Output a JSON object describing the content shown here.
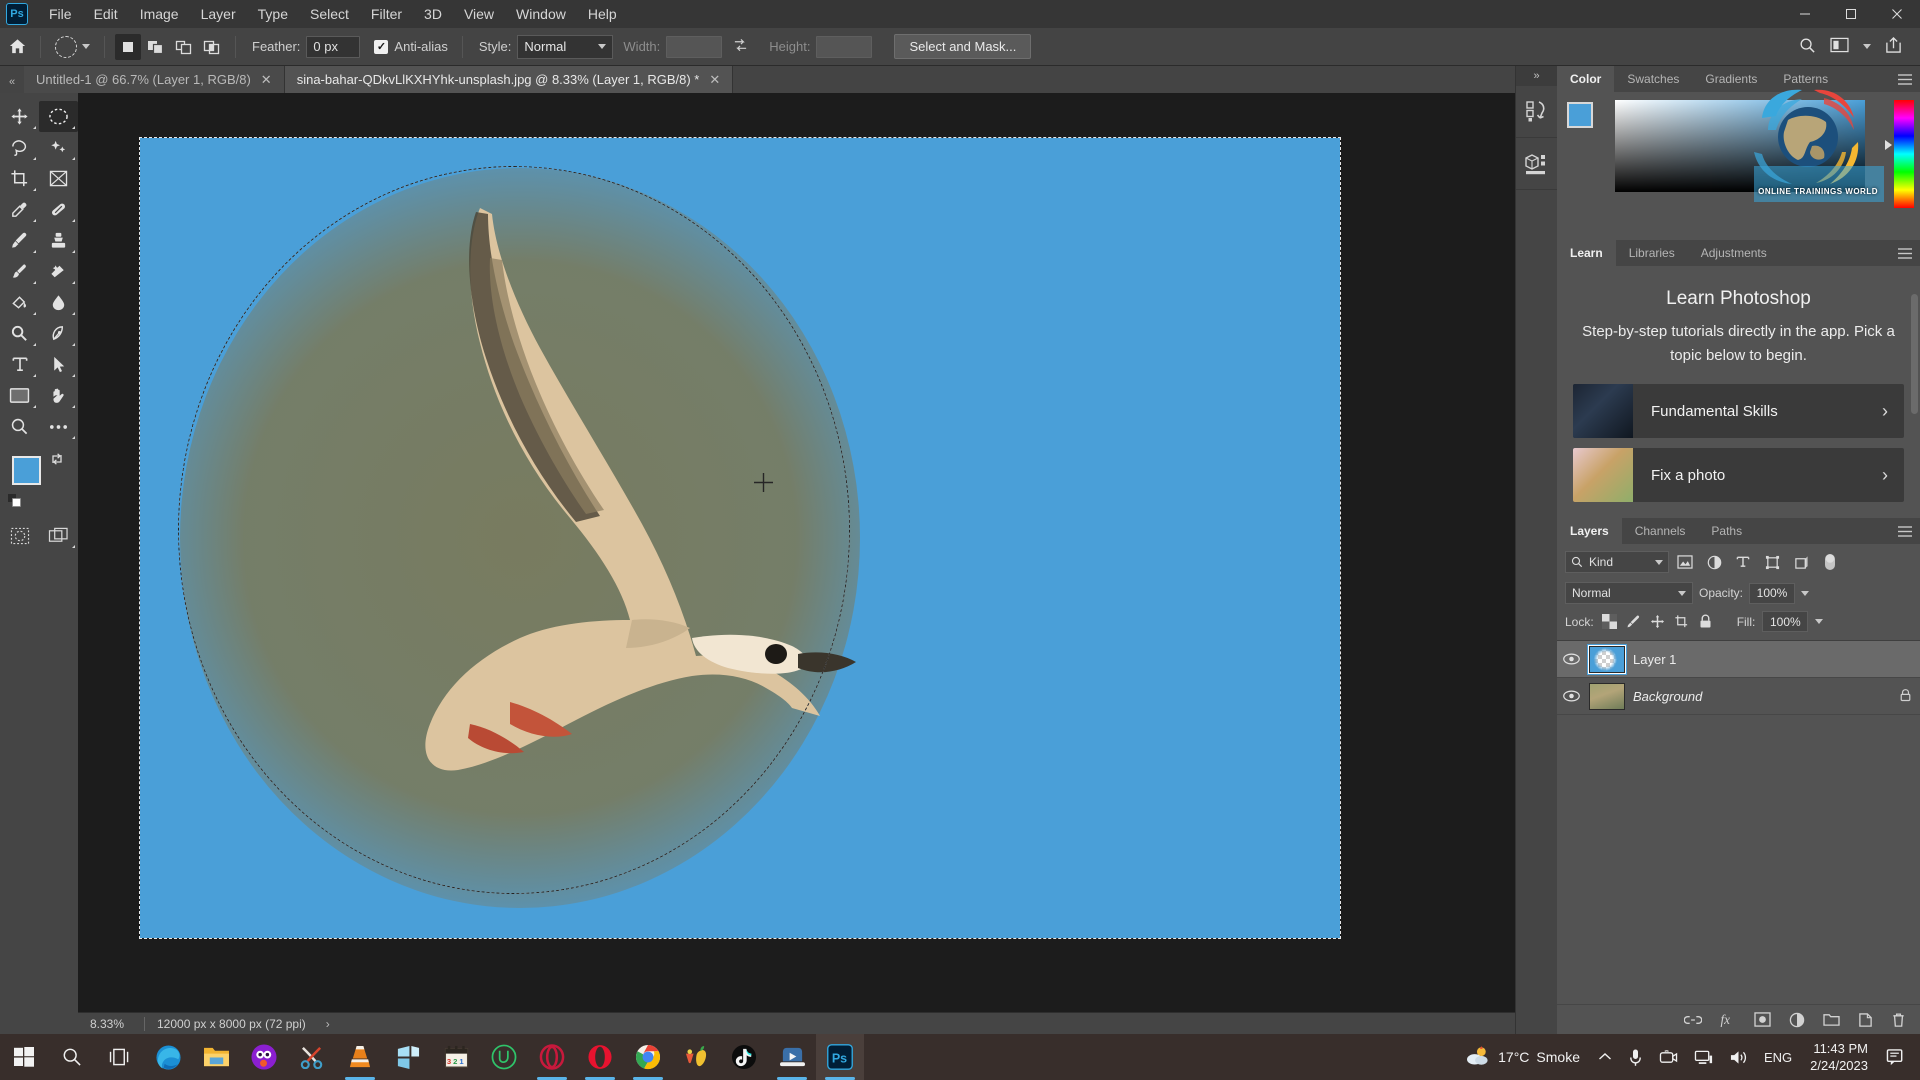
{
  "menubar": {
    "app_icon": "photoshop-logo-icon",
    "items": [
      "File",
      "Edit",
      "Image",
      "Layer",
      "Type",
      "Select",
      "Filter",
      "3D",
      "View",
      "Window",
      "Help"
    ],
    "window_controls": [
      {
        "name": "minimize",
        "glyph": "—"
      },
      {
        "name": "maximize",
        "glyph": "❐"
      },
      {
        "name": "close",
        "glyph": "✕"
      }
    ]
  },
  "options_bar": {
    "home_icon": "home-icon",
    "tool_preset_label": "elliptical-marquee-tool",
    "selection_modes": [
      "new-selection",
      "add-to-selection",
      "subtract-from-selection",
      "intersect-with-selection"
    ],
    "active_selection_mode": 0,
    "feather_label": "Feather:",
    "feather_value": "0 px",
    "antialias_label": "Anti-alias",
    "antialias_checked": true,
    "style_label": "Style:",
    "style_value": "Normal",
    "width_label": "Width:",
    "width_value": "",
    "swap_icon": "swap-width-height-icon",
    "height_label": "Height:",
    "height_value": "",
    "select_and_mask_label": "Select and Mask...",
    "right_icons": [
      "search-icon",
      "arrange-documents-icon",
      "chevron-down-icon",
      "share-icon"
    ]
  },
  "tab_bar": {
    "collapse_glyph": "«",
    "tabs": [
      {
        "title": "Untitled-1 @ 66.7% (Layer 1, RGB/8)",
        "active": false,
        "close": "✕"
      },
      {
        "title": "sina-bahar-QDkvLlKXHYhk-unsplash.jpg @ 8.33% (Layer 1, RGB/8) *",
        "active": true,
        "close": "✕"
      }
    ]
  },
  "toolbar": {
    "tools": [
      {
        "name": "move-tool",
        "active": false
      },
      {
        "name": "elliptical-marquee-tool",
        "active": true
      },
      {
        "name": "lasso-tool",
        "active": false
      },
      {
        "name": "object-selection-tool",
        "active": false
      },
      {
        "name": "crop-tool",
        "active": false
      },
      {
        "name": "frame-tool",
        "active": false
      },
      {
        "name": "eyedropper-tool",
        "active": false
      },
      {
        "name": "spot-healing-brush-tool",
        "active": false
      },
      {
        "name": "brush-tool",
        "active": false
      },
      {
        "name": "clone-stamp-tool",
        "active": false
      },
      {
        "name": "history-brush-tool",
        "active": false
      },
      {
        "name": "eraser-tool",
        "active": false
      },
      {
        "name": "gradient-tool",
        "active": false
      },
      {
        "name": "blur-tool",
        "active": false
      },
      {
        "name": "dodge-tool",
        "active": false
      },
      {
        "name": "pen-tool",
        "active": false
      },
      {
        "name": "horizontal-type-tool",
        "active": false
      },
      {
        "name": "path-selection-tool",
        "active": false
      },
      {
        "name": "rectangle-tool",
        "active": false
      },
      {
        "name": "hand-tool",
        "active": false
      },
      {
        "name": "zoom-tool",
        "active": false
      },
      {
        "name": "edit-toolbar-tool",
        "active": false
      }
    ],
    "foreground_color": "#4a9fd8",
    "background_color": "#ffffff",
    "swap_icon": "swap-colors-icon",
    "reset_icon": "default-colors-icon",
    "bottom_tools": [
      {
        "name": "quick-mask-mode-icon"
      },
      {
        "name": "screen-mode-icon"
      }
    ]
  },
  "canvas": {
    "image_background_color": "#4a9fd8",
    "selection_shape": "ellipse",
    "cursor_icon": "crosshair-cursor"
  },
  "status_bar": {
    "zoom": "8.33%",
    "dimensions": "12000 px x 8000 px (72 ppi)",
    "expand_glyph": "›"
  },
  "dock_strip": {
    "collapse_glyph": "»",
    "buttons": [
      "history-panel-icon",
      "properties-panel-icon"
    ]
  },
  "color_panel": {
    "tabs": [
      "Color",
      "Swatches",
      "Gradients",
      "Patterns"
    ],
    "active_tab": "Color",
    "foreground": "#4a9fd8",
    "background": "#ffffff",
    "menu_icon": "panel-menu-icon",
    "watermark_text": "ONLINE TRAININGS WORLD"
  },
  "learn_panel": {
    "tabs": [
      "Learn",
      "Libraries",
      "Adjustments"
    ],
    "active_tab": "Learn",
    "title": "Learn Photoshop",
    "subtitle": "Step-by-step tutorials directly in the app. Pick a topic below to begin.",
    "cards": [
      {
        "label": "Fundamental Skills",
        "chevron": "›",
        "thumb": "dark-room-thumbnail"
      },
      {
        "label": "Fix a photo",
        "chevron": "›",
        "thumb": "flowers-thumbnail"
      }
    ]
  },
  "layers_panel": {
    "tabs": [
      "Layers",
      "Channels",
      "Paths"
    ],
    "active_tab": "Layers",
    "filter_label": "Kind",
    "filter_icon": "search-icon",
    "filter_type_icons": [
      "pixel-layer-filter-icon",
      "adjustment-layer-filter-icon",
      "type-layer-filter-icon",
      "shape-layer-filter-icon",
      "smart-object-filter-icon"
    ],
    "filter_toggle_icon": "filter-toggle-icon",
    "blend_mode": "Normal",
    "opacity_label": "Opacity:",
    "opacity_value": "100%",
    "lock_label": "Lock:",
    "lock_icons": [
      "lock-transparent-pixels-icon",
      "lock-image-pixels-icon",
      "lock-position-icon",
      "lock-artboard-icon",
      "lock-all-icon"
    ],
    "fill_label": "Fill:",
    "fill_value": "100%",
    "layers": [
      {
        "name": "Layer 1",
        "visible": true,
        "selected": true,
        "locked": false,
        "italic": false
      },
      {
        "name": "Background",
        "visible": true,
        "selected": false,
        "locked": true,
        "italic": true
      }
    ],
    "footer_icons": [
      "link-layers-icon",
      "layer-style-icon",
      "layer-mask-icon",
      "adjustment-layer-icon",
      "new-group-icon",
      "new-layer-icon",
      "delete-layer-icon"
    ]
  },
  "taskbar": {
    "start_icon": "windows-start-icon",
    "search_icon": "search-icon",
    "task-view_icon": "task-view-icon",
    "apps": [
      {
        "name": "microsoft-edge",
        "running": false
      },
      {
        "name": "file-explorer",
        "running": false
      },
      {
        "name": "app-purple",
        "running": false
      },
      {
        "name": "snipping-tool",
        "running": false
      },
      {
        "name": "vlc-media-player",
        "running": true
      },
      {
        "name": "microsoft-store",
        "running": false
      },
      {
        "name": "calendar-app",
        "running": false
      },
      {
        "name": "iobit-uninstaller",
        "running": false
      },
      {
        "name": "opera-gx",
        "running": true
      },
      {
        "name": "opera-browser",
        "running": true
      },
      {
        "name": "google-chrome",
        "running": true
      },
      {
        "name": "fruit-app",
        "running": false
      },
      {
        "name": "tiktok",
        "running": false
      },
      {
        "name": "filmora",
        "running": true
      },
      {
        "name": "photoshop",
        "running": true,
        "active": true
      }
    ],
    "tray": {
      "weather_temp": "17°C",
      "weather_condition": "Smoke",
      "weather_icon": "sun-cloud-icon",
      "chevron_icon": "show-hidden-icons-icon",
      "icons": [
        "microphone-icon",
        "camera-icon",
        "network-icon",
        "volume-icon"
      ],
      "language": "ENG",
      "time": "11:43 PM",
      "date": "2/24/2023",
      "notifications_icon": "notifications-icon"
    }
  }
}
